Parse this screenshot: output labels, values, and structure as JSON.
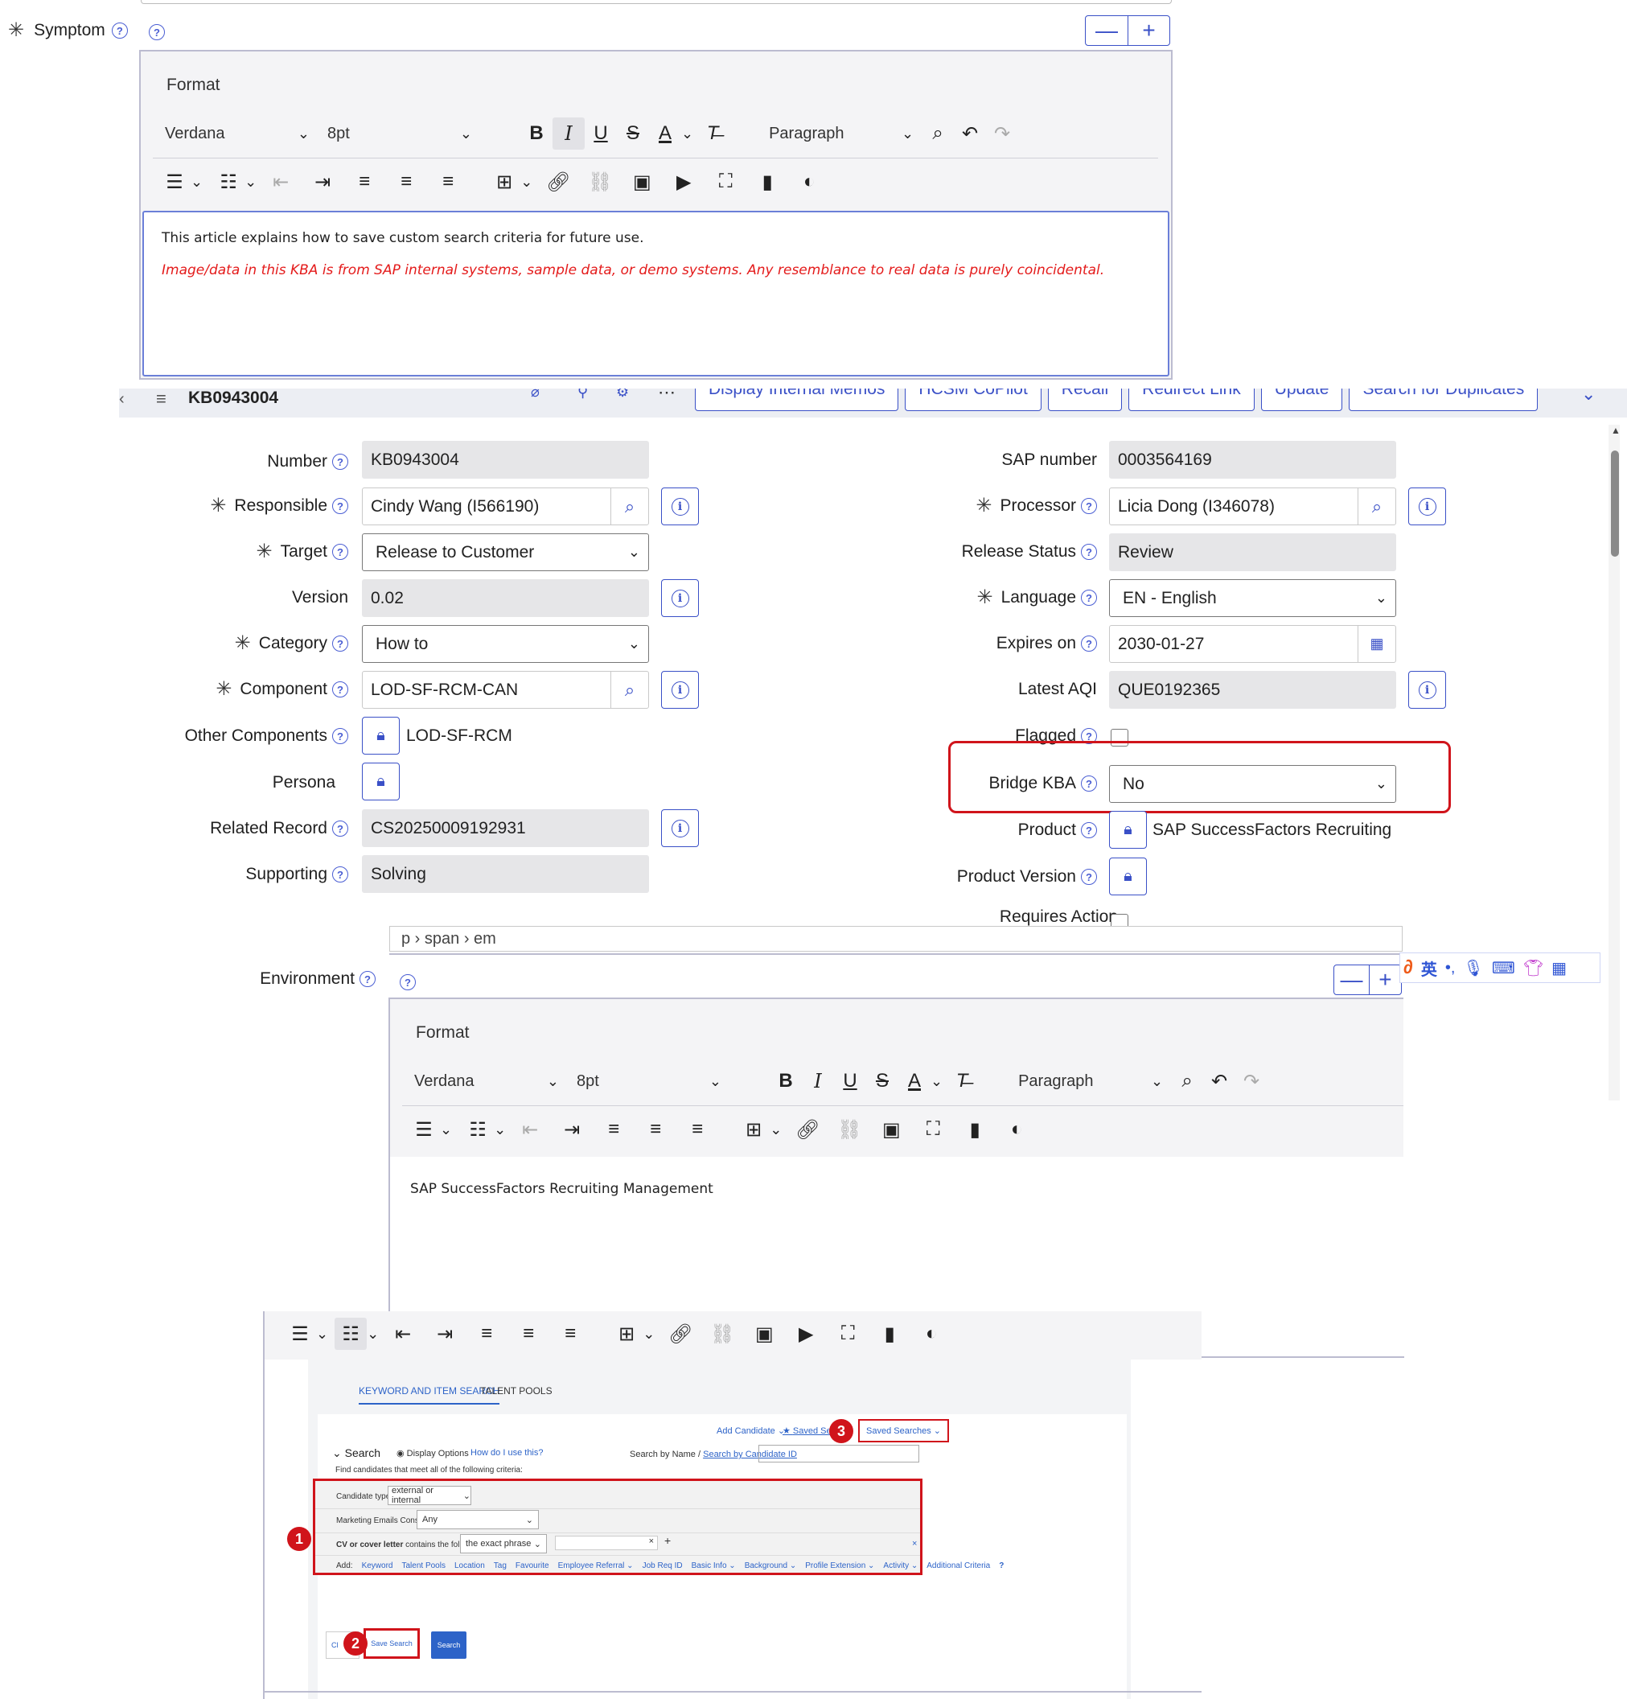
{
  "symptom": {
    "label": "Symptom",
    "format_label": "Format",
    "font": "Verdana",
    "size": "8pt",
    "paragraph": "Paragraph",
    "text_line1": "This article explains how to save custom search criteria for future use.",
    "text_line2": "Image/data in this KBA is from SAP internal systems, sample data, or demo systems. Any resemblance to real data is purely coincidental.",
    "minus": "—",
    "plus": "+"
  },
  "header": {
    "id": "KB0943004",
    "buttons": [
      "Display Internal Memos",
      "HCSM CoPilot",
      "Recall",
      "Redirect Link",
      "Update",
      "Search for Duplicates"
    ]
  },
  "form_left": {
    "number": {
      "label": "Number",
      "value": "KB0943004"
    },
    "responsible": {
      "label": "Responsible",
      "value": "Cindy Wang (I566190)"
    },
    "target": {
      "label": "Target",
      "value": "Release to Customer"
    },
    "version": {
      "label": "Version",
      "value": "0.02"
    },
    "category": {
      "label": "Category",
      "value": "How to"
    },
    "component": {
      "label": "Component",
      "value": "LOD-SF-RCM-CAN"
    },
    "other_components": {
      "label": "Other Components",
      "value": "LOD-SF-RCM"
    },
    "persona": {
      "label": "Persona"
    },
    "related_record": {
      "label": "Related Record",
      "value": "CS20250009192931"
    },
    "supporting": {
      "label": "Supporting",
      "value": "Solving"
    }
  },
  "form_right": {
    "sap_number": {
      "label": "SAP number",
      "value": "0003564169"
    },
    "processor": {
      "label": "Processor",
      "value": "Licia Dong (I346078)"
    },
    "release_status": {
      "label": "Release Status",
      "value": "Review"
    },
    "language": {
      "label": "Language",
      "value": "EN - English"
    },
    "expires_on": {
      "label": "Expires on",
      "value": "2030-01-27"
    },
    "latest_aqi": {
      "label": "Latest AQI",
      "value": "QUE0192365"
    },
    "flagged": {
      "label": "Flagged"
    },
    "bridge_kba": {
      "label": "Bridge KBA",
      "value": "No"
    },
    "product": {
      "label": "Product",
      "value": "SAP SuccessFactors Recruiting"
    },
    "product_version": {
      "label": "Product Version"
    },
    "requires_action": {
      "label": "Requires Action"
    }
  },
  "breadcrumb": "p › span › em",
  "environment": {
    "label": "Environment",
    "format_label": "Format",
    "font": "Verdana",
    "size": "8pt",
    "paragraph": "Paragraph",
    "text": "SAP SuccessFactors Recruiting Management"
  },
  "ime": {
    "lang": "英",
    "punct": "•,"
  },
  "embedded": {
    "tabs": [
      "KEYWORD AND ITEM SEARCH",
      "TALENT POOLS"
    ],
    "add_candidate": "Add Candidate",
    "saved_search_link": "Saved Sea",
    "saved_searches": "Saved Searches",
    "search": "Search",
    "display_options": "Display Options",
    "how_do_i": "How do I use this?",
    "search_by_name": "Search by Name /",
    "search_by_id": "Search by Candidate ID",
    "find_text": "Find candidates that meet all of the following criteria:",
    "candidate_type_label": "Candidate type:",
    "candidate_type_value": "external or internal",
    "marketing_label": "Marketing Emails Consent",
    "marketing_value": "Any",
    "cv_label_bold": "CV or cover letter",
    "cv_label_rest": "contains the following:",
    "cv_value": "the exact phrase",
    "add_label": "Add:",
    "add_links": [
      "Keyword",
      "Talent Pools",
      "Location",
      "Tag",
      "Favourite",
      "Employee Referral ⌄",
      "Job Req ID",
      "Basic Info ⌄",
      "Background ⌄",
      "Profile Extension ⌄",
      "Activity ⌄",
      "Additional Criteria"
    ],
    "clear": "Cl",
    "save_search": "Save Search",
    "search_btn": "Search",
    "markers": [
      "1",
      "2",
      "3"
    ]
  }
}
